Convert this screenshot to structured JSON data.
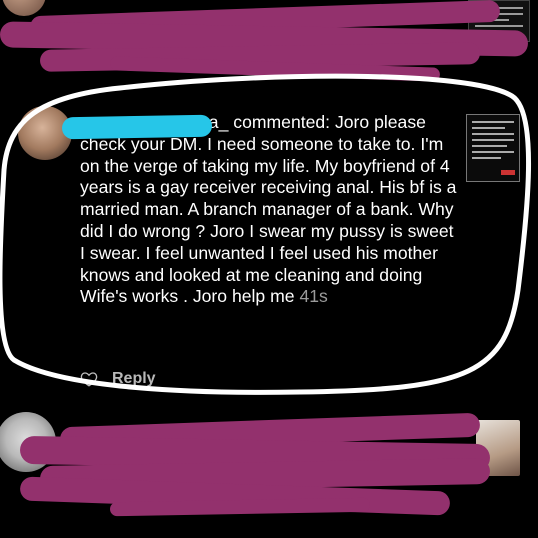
{
  "comment": {
    "username_suffix": "va_",
    "verb": "commented:",
    "text": "Joro please check your DM. I need someone to take to. I'm on the verge of taking my life. My boyfriend of 4 years is a gay receiver receiving anal. His bf is a married man. A branch manager of a bank. Why did I do wrong ? Joro I swear my pussy is sweet I swear. I feel unwanted I feel used his mother knows and looked at me cleaning and doing Wife's works . Joro help me",
    "timestamp": "41s",
    "reply_label": "Reply"
  },
  "icons": {
    "like": "heart-outline-icon"
  },
  "colors": {
    "background": "#000000",
    "censor_magenta": "#93316d",
    "censor_cyan": "#26c6e8",
    "circle_outline": "#ffffff",
    "timestamp_gray": "#9b9b9b"
  }
}
